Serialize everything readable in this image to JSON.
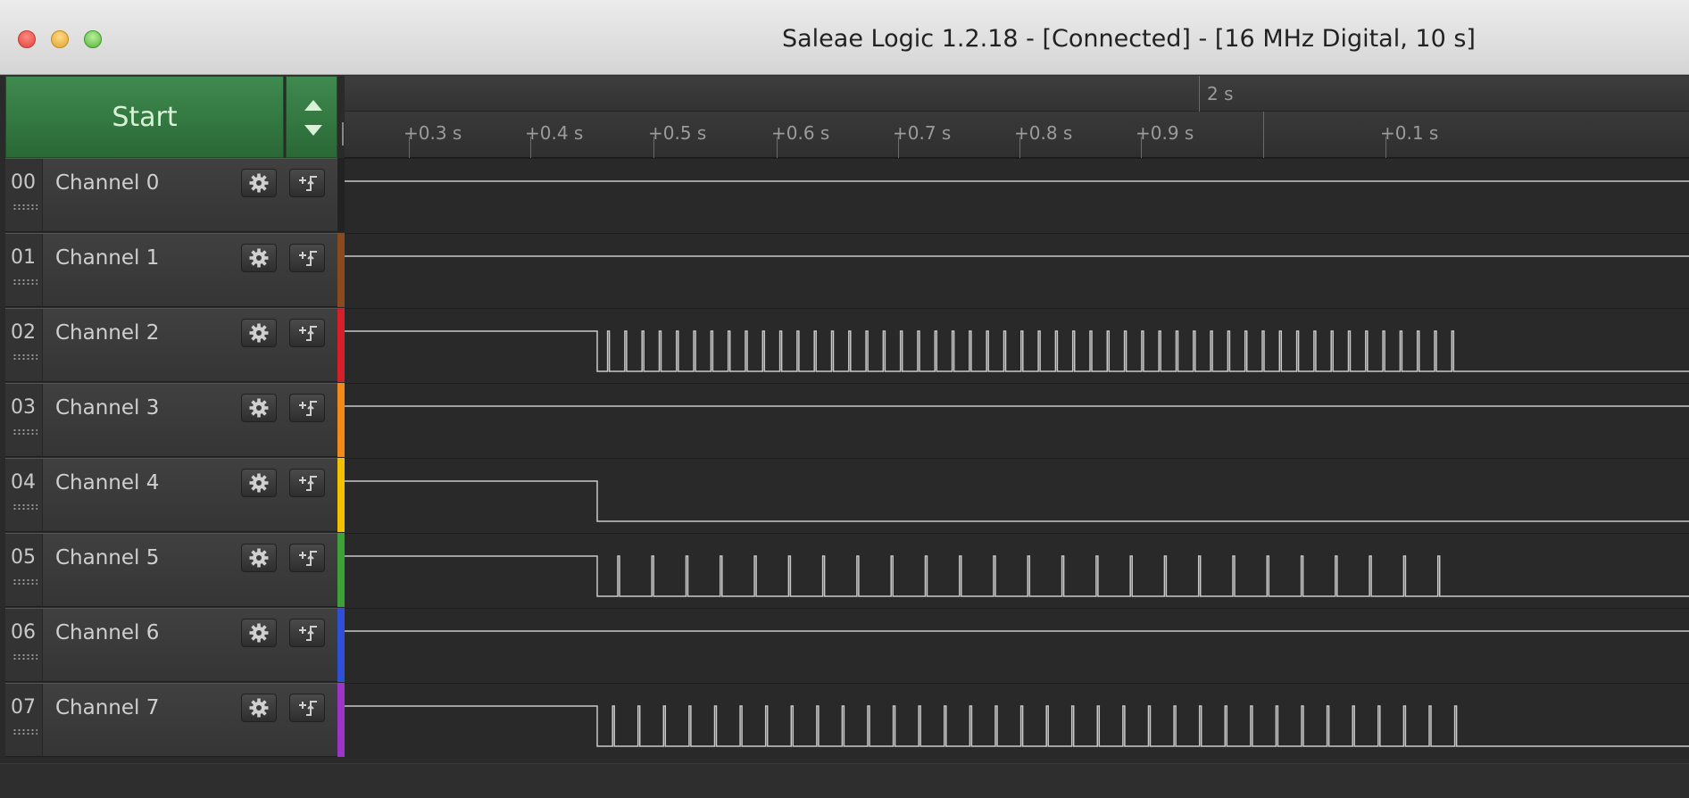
{
  "window": {
    "title": "Saleae Logic 1.2.18 - [Connected] - [16 MHz Digital, 10 s]"
  },
  "controls": {
    "start_label": "Start"
  },
  "ruler": {
    "top_label": "2 s",
    "ticks": [
      "+0.3 s",
      "+0.4 s",
      "+0.5 s",
      "+0.6 s",
      "+0.7 s",
      "+0.8 s",
      "+0.9 s",
      "+0.1 s"
    ]
  },
  "channels": [
    {
      "number": "00",
      "name": "Channel 0",
      "color": "#222222",
      "signal": "high"
    },
    {
      "number": "01",
      "name": "Channel 1",
      "color": "#8b4a1e",
      "signal": "high"
    },
    {
      "number": "02",
      "name": "Channel 2",
      "color": "#d4202a",
      "signal": "burst-fast"
    },
    {
      "number": "03",
      "name": "Channel 3",
      "color": "#f08a18",
      "signal": "high"
    },
    {
      "number": "04",
      "name": "Channel 4",
      "color": "#f2c200",
      "signal": "falling"
    },
    {
      "number": "05",
      "name": "Channel 5",
      "color": "#3da13a",
      "signal": "burst-slow"
    },
    {
      "number": "06",
      "name": "Channel 6",
      "color": "#2f4fd6",
      "signal": "high"
    },
    {
      "number": "07",
      "name": "Channel 7",
      "color": "#9a35c8",
      "signal": "burst-medium"
    }
  ]
}
